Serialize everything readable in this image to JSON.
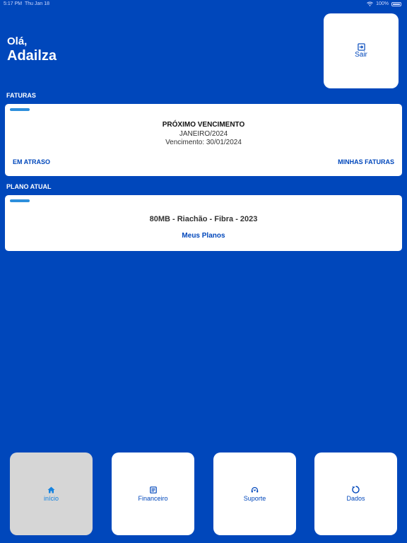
{
  "status_bar": {
    "time": "5:17 PM",
    "date": "Thu Jan 18",
    "battery": "100%"
  },
  "greeting": {
    "hello": "Olá,",
    "name": "Adailza"
  },
  "logout": {
    "label": "Sair",
    "icon": "logout-icon"
  },
  "invoices": {
    "section_label": "FATURAS",
    "title": "PRÓXIMO VENCIMENTO",
    "month": "JANEIRO/2024",
    "due": "Vencimento: 30/01/2024",
    "overdue_link": "EM ATRASO",
    "my_invoices_link": "MINHAS FATURAS"
  },
  "plan": {
    "section_label": "PLANO ATUAL",
    "name": "80MB - Riachão - Fibra - 2023",
    "link": "Meus Planos"
  },
  "tabs": [
    {
      "label": "início",
      "icon": "home-icon",
      "active": true
    },
    {
      "label": "Financeiro",
      "icon": "document-icon",
      "active": false
    },
    {
      "label": "Suporte",
      "icon": "headset-icon",
      "active": false
    },
    {
      "label": "Dados",
      "icon": "refresh-icon",
      "active": false
    }
  ],
  "colors": {
    "background": "#0047BB",
    "accent": "#2D8FDC",
    "active_tab": "#D6D6D6"
  }
}
